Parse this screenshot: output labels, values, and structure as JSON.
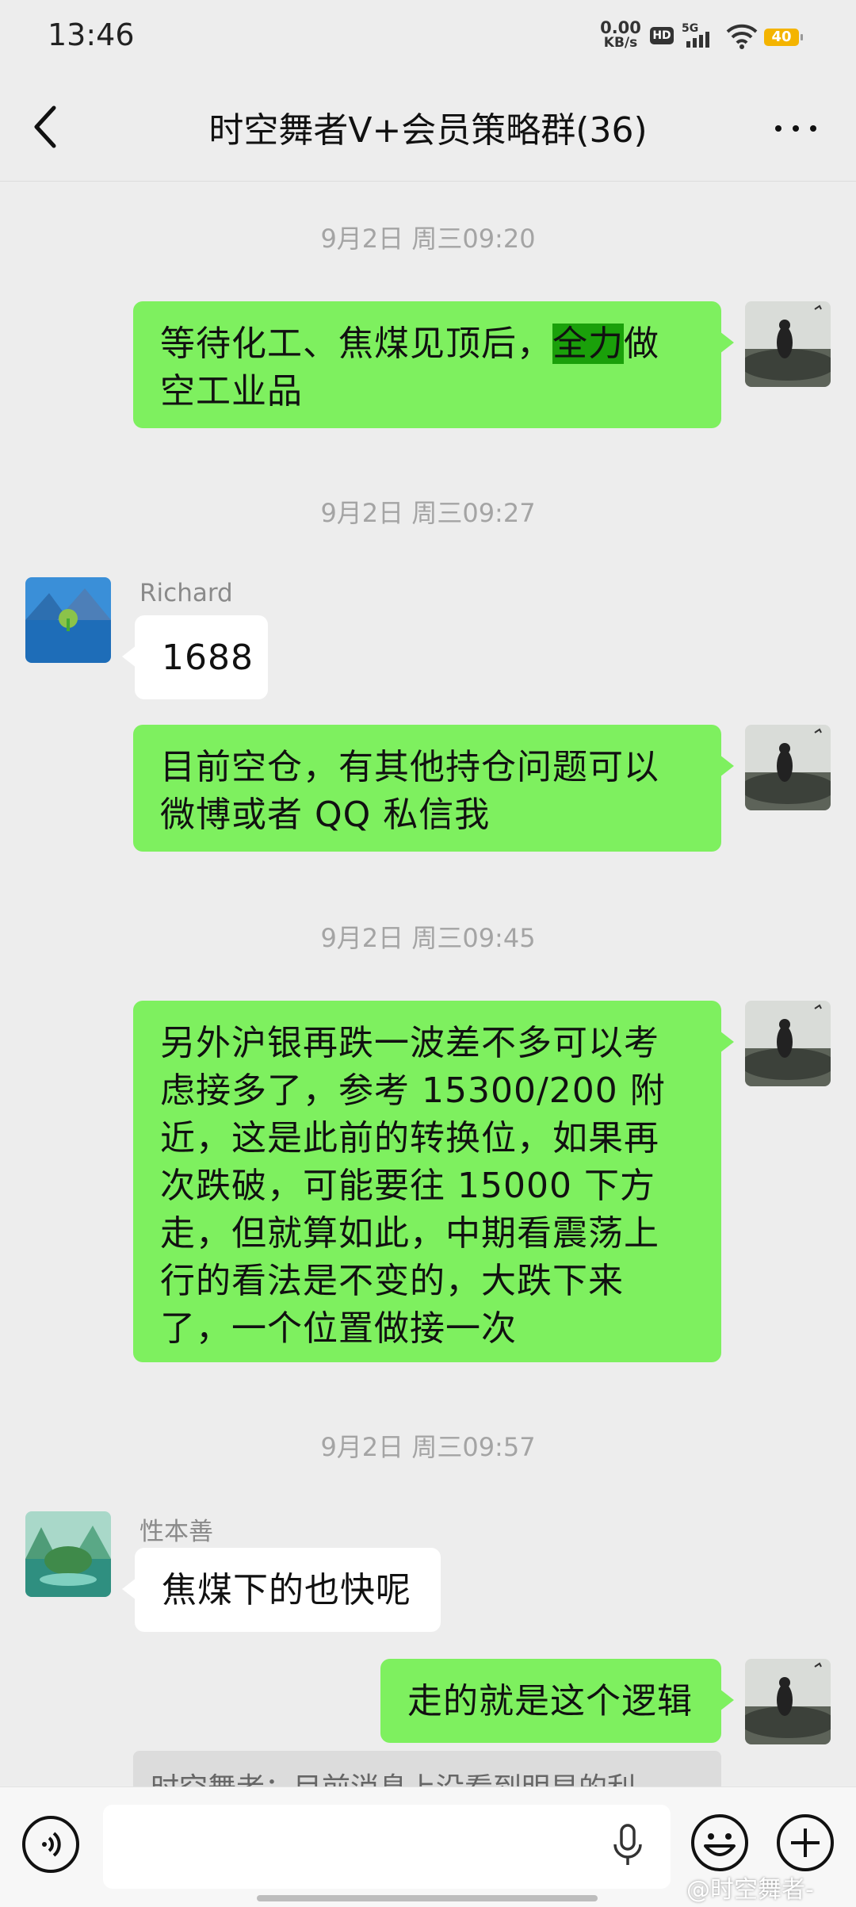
{
  "status_bar": {
    "time": "13:46",
    "net_speed_value": "0.00",
    "net_speed_unit": "KB/s",
    "hd_label": "HD",
    "network_label": "5G",
    "battery": "40"
  },
  "header": {
    "title": "时空舞者V+会员策略群(36)"
  },
  "messages": {
    "ts1": "9月2日 周三09:20",
    "m1_before": "等待化工、焦煤见顶后，",
    "m1_highlight": "全力",
    "m1_after": "做空工业品",
    "ts2": "9月2日 周三09:27",
    "richard_name": "Richard",
    "richard_msg": "1688",
    "m2": "目前空仓，有其他持仓问题可以微博或者 QQ 私信我",
    "ts3": "9月2日 周三09:45",
    "m3": "另外沪银再跌一波差不多可以考虑接多了，参考 15300/200 附近，这是此前的转换位，如果再次跌破，可能要往 15000 下方走，但就算如此，中期看震荡上行的看法是不变的，大跌下来了，一个位置做接一次",
    "ts4": "9月2日 周三09:57",
    "xing_name": "性本善",
    "xing_msg": "焦煤下的也快呢",
    "m4": "走的就是这个逻辑",
    "quote": "时空舞者：目前消息上没看到明显的利"
  },
  "watermark": "@时空舞者-",
  "colors": {
    "outgoing_bubble": "#7ef05f",
    "incoming_bubble": "#ffffff",
    "background": "#ededed",
    "battery": "#f4b400"
  }
}
